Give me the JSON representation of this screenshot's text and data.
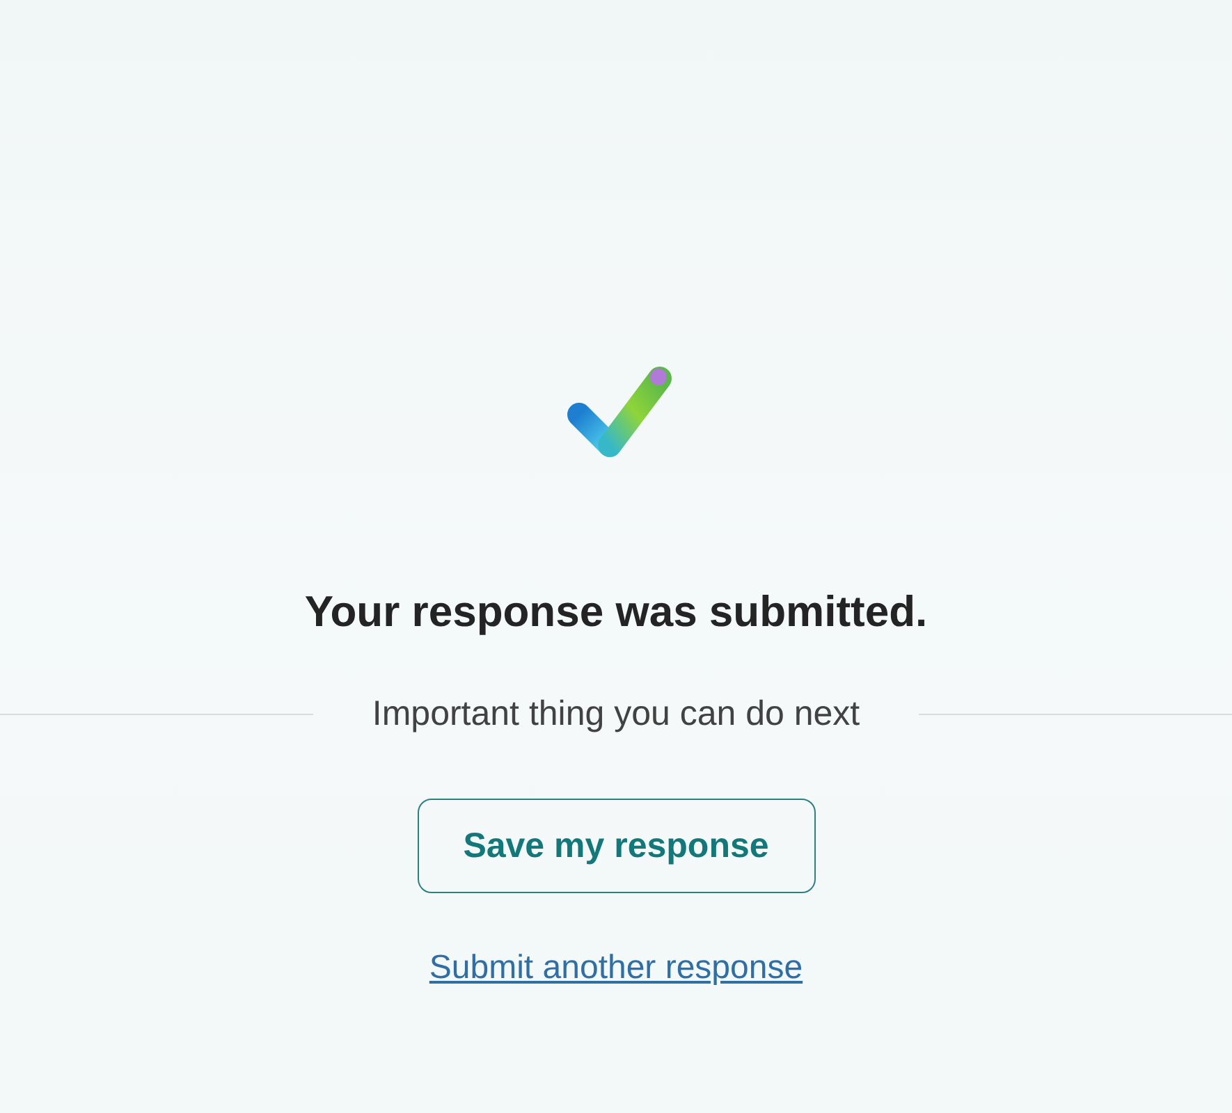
{
  "title": "Your response was submitted.",
  "next_heading": "Important thing you can do next",
  "save_button": "Save my response",
  "another_link": "Submit another response"
}
